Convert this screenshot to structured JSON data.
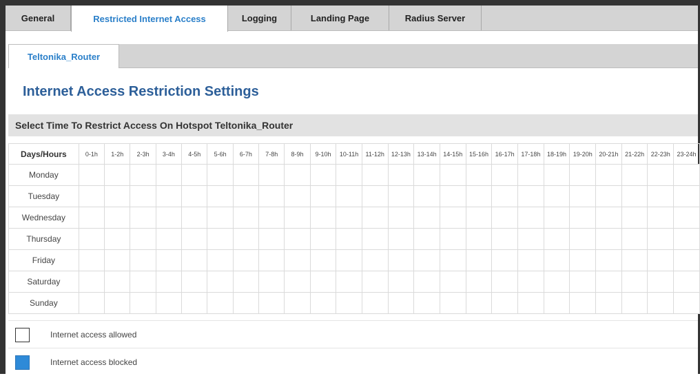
{
  "tabs": [
    {
      "label": "General",
      "active": false
    },
    {
      "label": "Restricted Internet Access",
      "active": true
    },
    {
      "label": "Logging",
      "active": false
    },
    {
      "label": "Landing Page",
      "active": false
    },
    {
      "label": "Radius Server",
      "active": false
    }
  ],
  "sub_tabs": [
    {
      "label": "Teltonika_Router",
      "active": true
    }
  ],
  "page_title": "Internet Access Restriction Settings",
  "section_header": "Select Time To Restrict Access On Hotspot Teltonika_Router",
  "schedule": {
    "corner_label": "Days/Hours",
    "hours": [
      "0-1h",
      "1-2h",
      "2-3h",
      "3-4h",
      "4-5h",
      "5-6h",
      "6-7h",
      "7-8h",
      "8-9h",
      "9-10h",
      "10-11h",
      "11-12h",
      "12-13h",
      "13-14h",
      "14-15h",
      "15-16h",
      "16-17h",
      "17-18h",
      "18-19h",
      "19-20h",
      "20-21h",
      "21-22h",
      "22-23h",
      "23-24h"
    ],
    "days": [
      "Monday",
      "Tuesday",
      "Wednesday",
      "Thursday",
      "Friday",
      "Saturday",
      "Sunday"
    ],
    "blocked": [],
    "blocked_color": "#2e8ad8"
  },
  "legend": {
    "allowed": "Internet access allowed",
    "blocked": "Internet access blocked"
  },
  "colors": {
    "accent": "#2a7fc9",
    "title": "#2d5f99",
    "tab_bar": "#d4d4d4"
  }
}
